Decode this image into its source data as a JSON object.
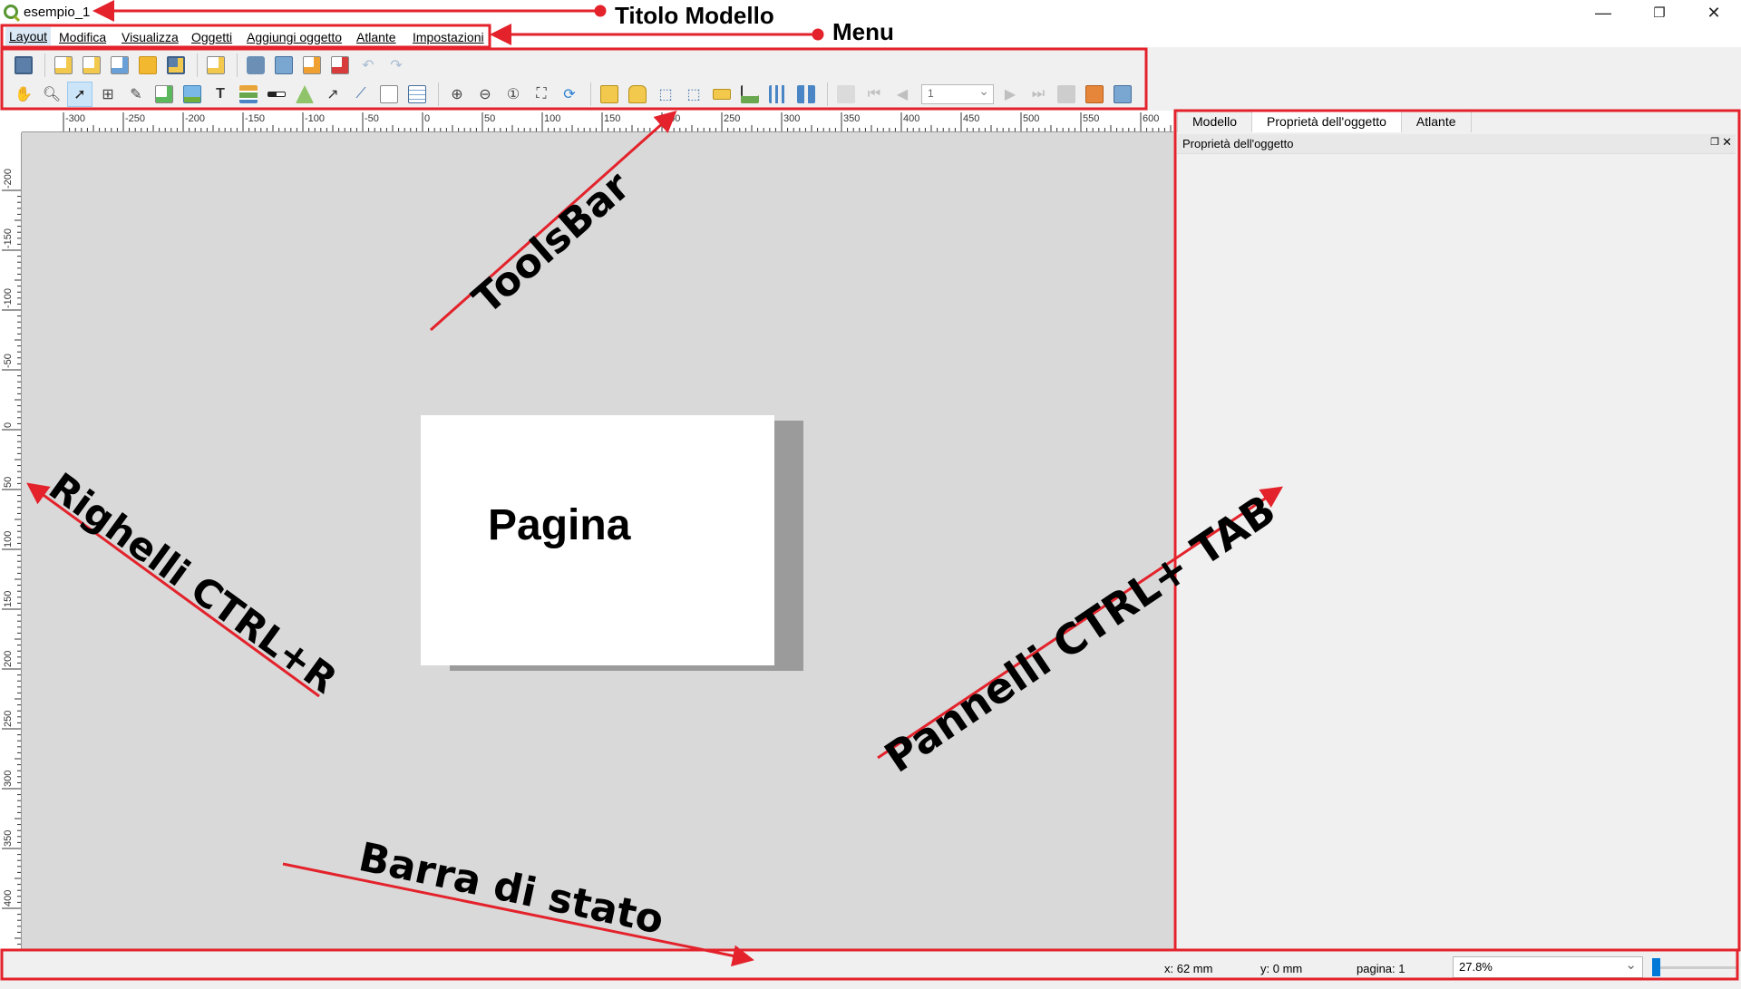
{
  "window": {
    "title": "esempio_1",
    "minimize": "—",
    "maximize": "❐",
    "close": "✕"
  },
  "menu": [
    "Layout",
    "Modifica",
    "Visualizza",
    "Oggetti",
    "Aggiungi oggetto",
    "Atlante",
    "Impostazioni"
  ],
  "toolbar": {
    "page_number": "1"
  },
  "rulers": {
    "horizontal_ticks": [
      "-300",
      "-250",
      "-200",
      "-150",
      "-100",
      "-50",
      "0",
      "50",
      "100",
      "150",
      "200",
      "250",
      "300",
      "350",
      "400",
      "450",
      "500",
      "550",
      "600"
    ],
    "vertical_ticks": [
      "-200",
      "-150",
      "-100",
      "-50",
      "0",
      "50",
      "100",
      "150",
      "200",
      "250",
      "300",
      "350",
      "400"
    ]
  },
  "panel": {
    "tabs": [
      "Modello",
      "Proprietà dell'oggetto",
      "Atlante"
    ],
    "active_tab": 1,
    "dock_title": "Proprietà dell'oggetto"
  },
  "statusbar": {
    "x": "x: 62 mm",
    "y": "y: 0 mm",
    "page": "pagina: 1",
    "zoom": "27.8%"
  },
  "annotations": {
    "title_label": "Titolo Modello",
    "menu_label": "Menu",
    "toolbar_label": "ToolsBar",
    "page_label": "Pagina",
    "rulers_label": "Righelli CTRL+R",
    "panels_label": "Pannelli CTRL+ TAB",
    "statusbar_label": "Barra di stato",
    "color": "#e3222b"
  }
}
